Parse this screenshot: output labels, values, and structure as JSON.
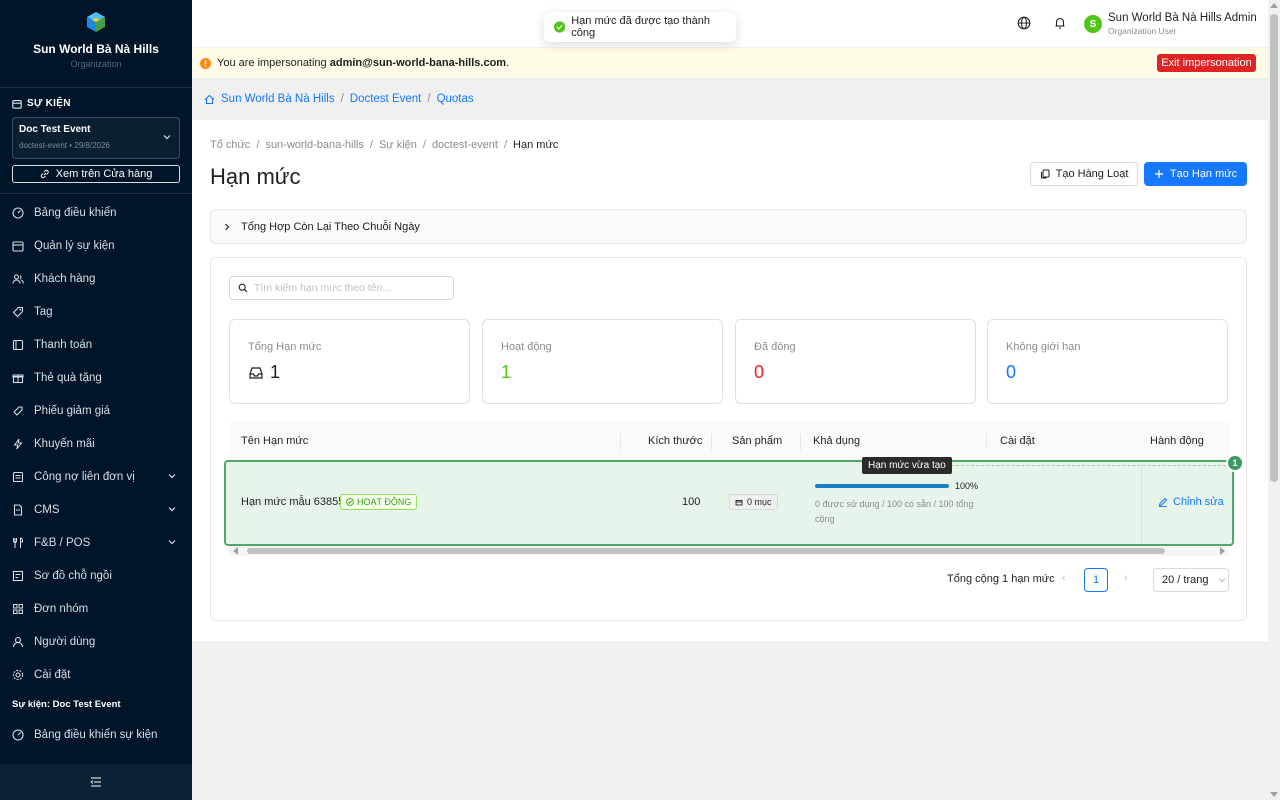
{
  "sidebar": {
    "brand_name": "Sun World Bà Nà Hills",
    "brand_sub": "Organization",
    "section_title": "SỰ KIỆN",
    "event": {
      "name": "Doc Test Event",
      "meta": "doctest-event • 29/8/2026"
    },
    "store_button": "Xem trên Cửa hàng",
    "menu": [
      {
        "label": "Bảng điều khiển",
        "icon": "dashboard-icon"
      },
      {
        "label": "Quản lý sự kiện",
        "icon": "calendar-icon"
      },
      {
        "label": "Khách hàng",
        "icon": "users-icon"
      },
      {
        "label": "Tag",
        "icon": "tag-icon"
      },
      {
        "label": "Thanh toán",
        "icon": "payment-icon"
      },
      {
        "label": "Thẻ quà tặng",
        "icon": "gift-icon"
      },
      {
        "label": "Phiếu giảm giá",
        "icon": "coupon-icon"
      },
      {
        "label": "Khuyến mãi",
        "icon": "lightning-icon"
      },
      {
        "label": "Công nợ liên đơn vị",
        "icon": "ledger-icon",
        "expandable": true
      },
      {
        "label": "CMS",
        "icon": "document-icon",
        "expandable": true
      },
      {
        "label": "F&B / POS",
        "icon": "fnb-icon",
        "expandable": true
      },
      {
        "label": "Sơ đồ chỗ ngồi",
        "icon": "seatmap-icon"
      },
      {
        "label": "Đơn nhóm",
        "icon": "grid-icon"
      },
      {
        "label": "Người dùng",
        "icon": "user-icon"
      },
      {
        "label": "Cài đặt",
        "icon": "gear-icon"
      }
    ],
    "event_section_label": "Sự kiện: Doc Test Event",
    "event_menu": [
      {
        "label": "Bảng điều khiển sự kiện",
        "icon": "dashboard-icon"
      }
    ]
  },
  "topbar": {
    "user_name": "Sun World Bà Nà Hills Admin",
    "user_role": "Organization User",
    "avatar_letter": "S"
  },
  "toast": {
    "message": "Hạn mức đã được tạo thành công"
  },
  "banner": {
    "prefix": "You are impersonating",
    "email": "admin@sun-world-bana-hills.com",
    "suffix": ".",
    "exit_label": "Exit impersonation"
  },
  "navstrip": [
    "Sun World Bà Nà Hills",
    "Doctest Event",
    "Quotas"
  ],
  "breadcrumbs": [
    "Tổ chức",
    "sun-world-bana-hills",
    "Sự kiện",
    "doctest-event",
    "Hạn mức"
  ],
  "page_title": "Hạn mức",
  "actions": {
    "bulk_label": "Tạo Hàng Loạt",
    "new_label": "Tạo Hạn mức"
  },
  "collapse_label": "Tổng Hợp Còn Lại Theo Chuỗi Ngày",
  "search_placeholder": "Tìm kiếm hạn mức theo tên...",
  "stats": [
    {
      "label": "Tổng Hạn mức",
      "value": "1",
      "color": "#1f1f1f",
      "icon": "inbox-icon"
    },
    {
      "label": "Hoạt động",
      "value": "1",
      "color": "#52c41a"
    },
    {
      "label": "Đã đóng",
      "value": "0",
      "color": "#f5222d"
    },
    {
      "label": "Không giới hạn",
      "value": "0",
      "color": "#1677ff"
    }
  ],
  "table": {
    "headers": [
      "Tên Hạn mức",
      "Kích thước",
      "Sản phẩm",
      "Khả dụng",
      "Cài đặt",
      "Hành động"
    ],
    "rows": [
      {
        "name": "Hạn mức mẫu 63855",
        "status": "HOẠT ĐỘNG",
        "size": "100",
        "products": "0 mục",
        "availability_pct": "100%",
        "availability_fraction": 1.0,
        "availability_text": "0 được sử dụng / 100 có sẵn / 100 tổng cộng",
        "action_label": "Chỉnh sửa",
        "badge": "1",
        "tooltip": "Hạn mức vừa tạo"
      }
    ]
  },
  "pagination": {
    "total": "Tổng cộng 1 hạn mức",
    "page": "1",
    "page_size": "20 / trang"
  },
  "colors": {
    "sidebar_bg": "#001529",
    "primary": "#1677ff",
    "danger": "#e02424",
    "success": "#52c41a",
    "highlight_row": "#e6f4ea"
  }
}
